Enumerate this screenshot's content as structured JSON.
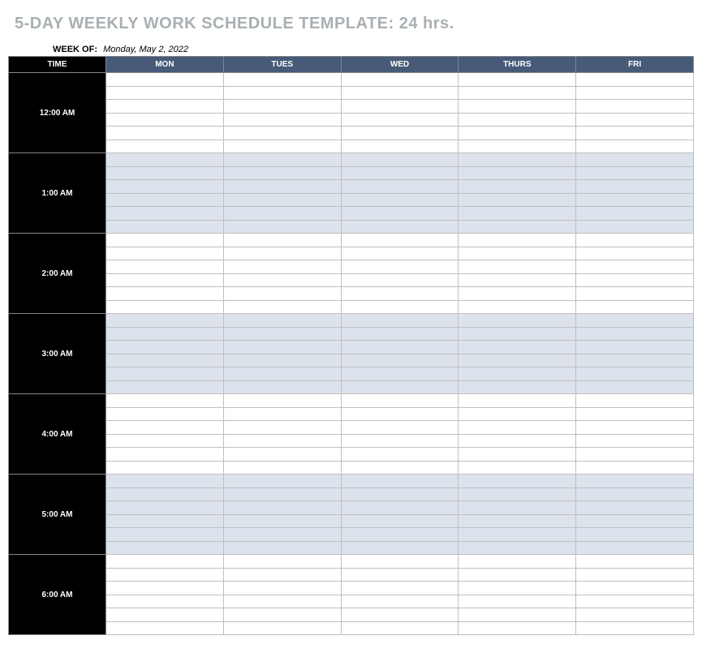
{
  "title": "5-DAY WEEKLY WORK SCHEDULE TEMPLATE: 24 hrs.",
  "week_label": "WEEK OF:",
  "week_value": "Monday, May 2, 2022",
  "headers": {
    "time": "TIME",
    "days": [
      "MON",
      "TUES",
      "WED",
      "THURS",
      "FRI"
    ]
  },
  "rows_per_hour": 6,
  "hours": [
    {
      "label": "12:00 AM",
      "shade": "even"
    },
    {
      "label": "1:00 AM",
      "shade": "odd"
    },
    {
      "label": "2:00 AM",
      "shade": "even"
    },
    {
      "label": "3:00 AM",
      "shade": "odd"
    },
    {
      "label": "4:00 AM",
      "shade": "even"
    },
    {
      "label": "5:00 AM",
      "shade": "odd"
    },
    {
      "label": "6:00 AM",
      "shade": "even"
    }
  ]
}
